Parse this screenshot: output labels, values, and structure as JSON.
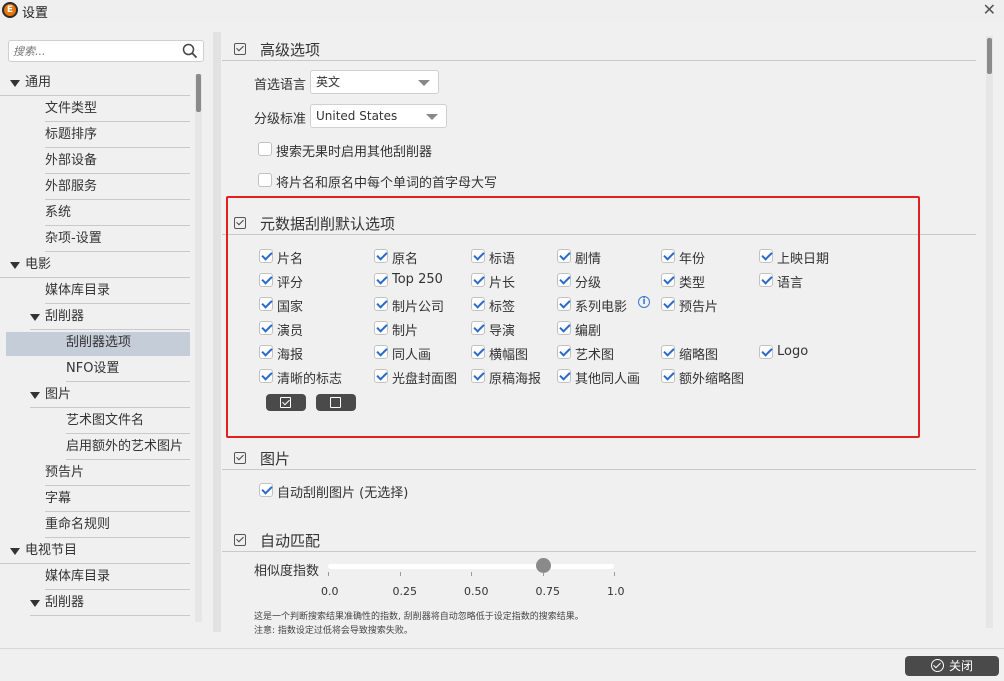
{
  "window": {
    "title": "设置",
    "app_icon_letter": "E"
  },
  "sidebar": {
    "search_placeholder": "搜索...",
    "items": [
      {
        "label": "通用"
      },
      {
        "label": "文件类型"
      },
      {
        "label": "标题排序"
      },
      {
        "label": "外部设备"
      },
      {
        "label": "外部服务"
      },
      {
        "label": "系统"
      },
      {
        "label": "杂项-设置"
      },
      {
        "label": "电影"
      },
      {
        "label": "媒体库目录"
      },
      {
        "label": "刮削器"
      },
      {
        "label": "刮削器选项"
      },
      {
        "label": "NFO设置"
      },
      {
        "label": "图片"
      },
      {
        "label": "艺术图文件名"
      },
      {
        "label": "启用额外的艺术图片"
      },
      {
        "label": "预告片"
      },
      {
        "label": "字幕"
      },
      {
        "label": "重命名规则"
      },
      {
        "label": "电视节目"
      },
      {
        "label": "媒体库目录"
      },
      {
        "label": "刮削器"
      }
    ]
  },
  "advanced": {
    "title": "高级选项",
    "language_label": "首选语言",
    "language_value": "英文",
    "rating_label": "分级标准",
    "rating_value": "United States",
    "fallback_label": "搜索无果时启用其他刮削器",
    "capitalize_label": "将片名和原名中每个单词的首字母大写"
  },
  "metadata": {
    "title": "元数据刮削默认选项",
    "rows": [
      [
        "片名",
        "原名",
        "标语",
        "剧情",
        "年份",
        "上映日期"
      ],
      [
        "评分",
        "Top 250",
        "片长",
        "分级",
        "类型",
        "语言"
      ],
      [
        "国家",
        "制片公司",
        "标签",
        "系列电影",
        "预告片"
      ],
      [
        "演员",
        "制片",
        "导演",
        "编剧"
      ],
      [
        "海报",
        "同人画",
        "横幅图",
        "艺术图",
        "缩略图",
        "Logo"
      ],
      [
        "清晰的标志",
        "光盘封面图",
        "原稿海报",
        "其他同人画",
        "额外缩略图"
      ]
    ]
  },
  "images": {
    "title": "图片",
    "auto_label": "自动刮削图片 (无选择)"
  },
  "automatch": {
    "title": "自动匹配",
    "similarity_label": "相似度指数",
    "similarity_value": 0.75,
    "ticks": [
      "0.0",
      "0.25",
      "0.50",
      "0.75",
      "1.0"
    ],
    "note1": "这是一个判断搜索结果准确性的指数, 刮削器将自动忽略低于设定指数的搜索结果。",
    "note2": "注意: 指数设定过低将会导致搜索失败。"
  },
  "footer": {
    "close_label": "关闭"
  },
  "colors": {
    "accent": "#2a6bc9",
    "highlight": "#e22020",
    "selected_bg": "#c5ced8"
  }
}
